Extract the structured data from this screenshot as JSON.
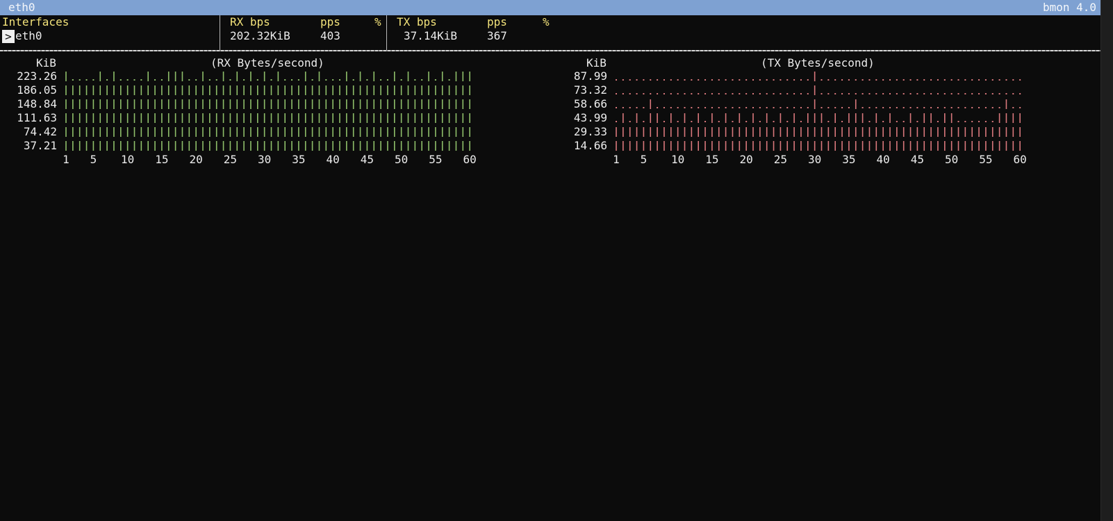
{
  "title": {
    "interface": "eth0",
    "app": "bmon 4.0"
  },
  "table": {
    "interfaces_header": "Interfaces",
    "rx_bps_header": "RX bps",
    "rx_pps_header": "pps",
    "rx_pct_header": "%",
    "tx_bps_header": "TX bps",
    "tx_pps_header": "pps",
    "tx_pct_header": "%",
    "row": {
      "cursor": ">",
      "name": "eth0",
      "rx_bps": "202.32KiB",
      "rx_pps": "403",
      "tx_bps": "37.14KiB",
      "tx_pps": "367"
    }
  },
  "colors": {
    "rx": "#8fbf6a",
    "tx": "#d9787c",
    "header": "#f2e27a",
    "titlebar": "#7ea1d2"
  },
  "chart_data": [
    {
      "type": "bar",
      "title": "(RX Bytes/second)",
      "ylabel": "KiB",
      "y_levels": [
        223.26,
        186.05,
        148.84,
        111.63,
        74.42,
        37.21
      ],
      "x_tick_labels": [
        "1",
        "5",
        "10",
        "15",
        "20",
        "25",
        "30",
        "35",
        "40",
        "45",
        "50",
        "55",
        "60"
      ],
      "x": [
        1,
        2,
        3,
        4,
        5,
        6,
        7,
        8,
        9,
        10,
        11,
        12,
        13,
        14,
        15,
        16,
        17,
        18,
        19,
        20,
        21,
        22,
        23,
        24,
        25,
        26,
        27,
        28,
        29,
        30,
        31,
        32,
        33,
        34,
        35,
        36,
        37,
        38,
        39,
        40,
        41,
        42,
        43,
        44,
        45,
        46,
        47,
        48,
        49,
        50,
        51,
        52,
        53,
        54,
        55,
        56,
        57,
        58,
        59,
        60
      ],
      "filled_rows_per_second": [
        6,
        5,
        5,
        5,
        5,
        6,
        5,
        6,
        5,
        5,
        5,
        5,
        6,
        5,
        5,
        6,
        6,
        6,
        5,
        5,
        6,
        5,
        5,
        6,
        5,
        6,
        5,
        6,
        5,
        6,
        5,
        6,
        5,
        5,
        5,
        6,
        5,
        6,
        5,
        5,
        5,
        6,
        5,
        6,
        5,
        6,
        5,
        5,
        6,
        5,
        6,
        5,
        5,
        6,
        5,
        6,
        5,
        6,
        6,
        6
      ],
      "grid": false
    },
    {
      "type": "bar",
      "title": "(TX Bytes/second)",
      "ylabel": "KiB",
      "y_levels": [
        87.99,
        73.32,
        58.66,
        43.99,
        29.33,
        14.66
      ],
      "x_tick_labels": [
        "1",
        "5",
        "10",
        "15",
        "20",
        "25",
        "30",
        "35",
        "40",
        "45",
        "50",
        "55",
        "60"
      ],
      "x": [
        1,
        2,
        3,
        4,
        5,
        6,
        7,
        8,
        9,
        10,
        11,
        12,
        13,
        14,
        15,
        16,
        17,
        18,
        19,
        20,
        21,
        22,
        23,
        24,
        25,
        26,
        27,
        28,
        29,
        30,
        31,
        32,
        33,
        34,
        35,
        36,
        37,
        38,
        39,
        40,
        41,
        42,
        43,
        44,
        45,
        46,
        47,
        48,
        49,
        50,
        51,
        52,
        53,
        54,
        55,
        56,
        57,
        58,
        59,
        60
      ],
      "filled_rows_per_second": [
        2,
        3,
        2,
        3,
        2,
        4,
        3,
        2,
        3,
        2,
        3,
        2,
        3,
        2,
        3,
        2,
        3,
        2,
        3,
        2,
        3,
        2,
        3,
        2,
        3,
        2,
        3,
        2,
        3,
        6,
        3,
        2,
        3,
        2,
        3,
        4,
        3,
        2,
        3,
        2,
        3,
        2,
        2,
        3,
        2,
        3,
        3,
        2,
        3,
        3,
        2,
        2,
        2,
        2,
        2,
        2,
        3,
        4,
        3,
        3
      ],
      "grid": false
    }
  ]
}
